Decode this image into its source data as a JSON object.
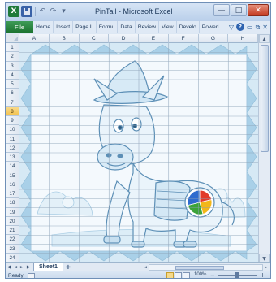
{
  "window": {
    "title": "PinTail - Microsoft Excel"
  },
  "quick_access": {
    "app_icon": "X",
    "save_icon": "disk",
    "undo_icon": "↶",
    "redo_icon": "↷",
    "customize_icon": "▾"
  },
  "window_controls": {
    "minimize": "—",
    "maximize": "□",
    "close": "✕"
  },
  "ribbon": {
    "file_tab": "File",
    "tabs": [
      "Home",
      "Insert",
      "Page L",
      "Formu",
      "Data",
      "Review",
      "View",
      "Develo",
      "Powerl"
    ],
    "icons": {
      "collapse": "▽",
      "help": "?",
      "minimize_ribbon": "▭",
      "restore": "⧉",
      "close": "✕"
    }
  },
  "grid": {
    "columns": [
      "A",
      "B",
      "C",
      "D",
      "E",
      "F",
      "G",
      "H"
    ],
    "rows": [
      "1",
      "2",
      "3",
      "4",
      "5",
      "6",
      "7",
      "8",
      "9",
      "10",
      "11",
      "12",
      "13",
      "14",
      "15",
      "16",
      "17",
      "18",
      "19",
      "20",
      "21",
      "22",
      "23",
      "24"
    ],
    "active_row": "8",
    "image_subject": "cartoon donkey with hat and pie-chart target on flank",
    "pie_colors": [
      "#2f6ccf",
      "#e23b2b",
      "#f2b71a",
      "#3ca33a"
    ]
  },
  "sheets": {
    "active": "Sheet1",
    "nav_first": "◀",
    "nav_prev": "◄",
    "nav_next": "►",
    "nav_last": "▶"
  },
  "status": {
    "ready": "Ready",
    "zoom": "100%",
    "zoom_out": "−",
    "zoom_in": "+"
  }
}
